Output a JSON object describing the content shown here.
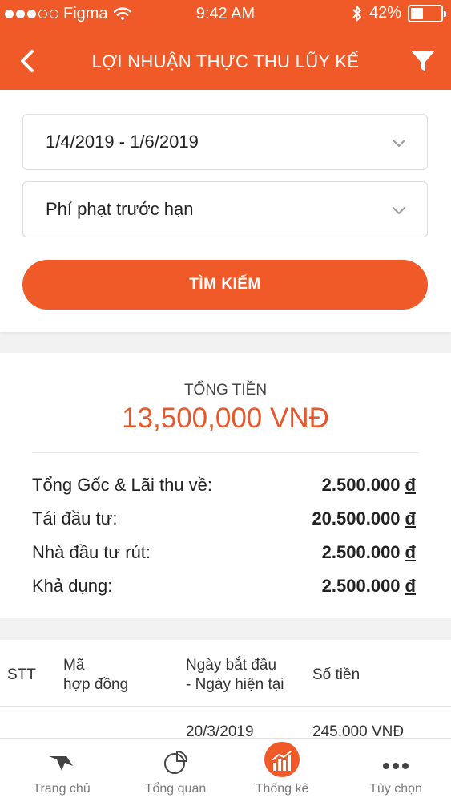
{
  "status_bar": {
    "carrier": "Figma",
    "time": "9:42 AM",
    "battery": "42%",
    "battery_level": 0.42
  },
  "header": {
    "title": "LỢI NHUẬN THỰC THU LŨY KẾ",
    "back_icon": "chevron-left-icon",
    "filter_icon": "filter-icon",
    "color": "#ef5a28"
  },
  "search": {
    "date_range": "1/4/2019 - 1/6/2019",
    "category": "Phí phạt trước hạn",
    "button_label": "TÌM KIẾM"
  },
  "summary": {
    "total_label": "TỔNG TIỀN",
    "total_value": "13,500,000 VNĐ",
    "currency_symbol": "đ",
    "rows": [
      {
        "label": "Tổng Gốc & Lãi thu về:",
        "value": "2.500.000"
      },
      {
        "label": "Tái đầu tư:",
        "value": "20.500.000"
      },
      {
        "label": "Nhà đầu tư rút:",
        "value": "2.500.000"
      },
      {
        "label": "Khả dụng:",
        "value": "2.500.000"
      }
    ]
  },
  "table": {
    "headers": {
      "stt": "STT",
      "contract_1": "Mã",
      "contract_2": "hợp đồng",
      "dates_1": "Ngày bắt đầu",
      "dates_2": "- Ngày hiện tại",
      "amount": "Số tiền"
    },
    "first_row": {
      "date": "20/3/2019",
      "amount": "245.000 VNĐ"
    }
  },
  "tabbar": {
    "items": [
      {
        "label": "Trang chủ",
        "icon": "home-bird-icon"
      },
      {
        "label": "Tổng quan",
        "icon": "pie-chart-icon"
      },
      {
        "label": "Thống kê",
        "icon": "bar-chart-icon"
      },
      {
        "label": "Tùy chọn",
        "icon": "more-dots-icon"
      }
    ],
    "active_index": 2
  }
}
